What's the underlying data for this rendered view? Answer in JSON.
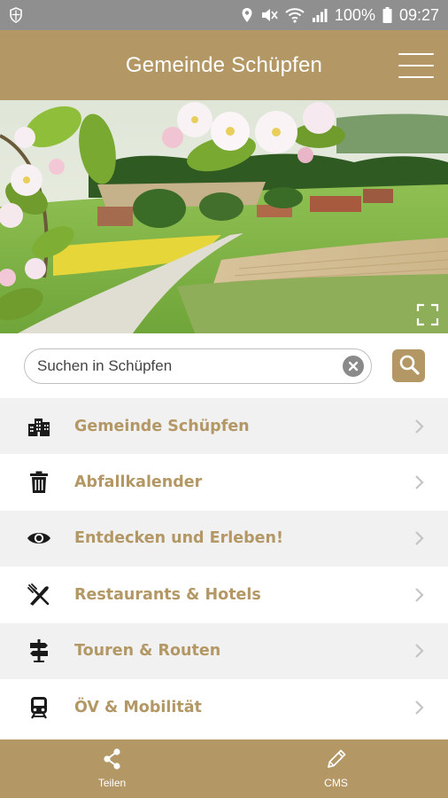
{
  "status_bar": {
    "battery": "100%",
    "time": "09:27",
    "icons": [
      "shield-icon",
      "location-icon",
      "mute-icon",
      "wifi-icon",
      "signal-icon",
      "battery-icon"
    ]
  },
  "header": {
    "title": "Gemeinde Schüpfen",
    "menu_icon": "hamburger-icon"
  },
  "hero": {
    "description_icon": "expand-icon"
  },
  "search": {
    "placeholder": "Suchen in Schüpfen",
    "value": ""
  },
  "menu": {
    "items": [
      {
        "label": "Gemeinde Schüpfen",
        "icon": "buildings-icon"
      },
      {
        "label": "Abfallkalender",
        "icon": "trash-icon"
      },
      {
        "label": "Entdecken und Erleben!",
        "icon": "eye-icon"
      },
      {
        "label": "Restaurants & Hotels",
        "icon": "fork-knife-icon"
      },
      {
        "label": "Touren & Routen",
        "icon": "signpost-icon"
      },
      {
        "label": "ÖV & Mobilität",
        "icon": "train-icon"
      }
    ]
  },
  "bottom_bar": {
    "share_label": "Teilen",
    "cms_label": "CMS"
  },
  "colors": {
    "brand": "#b39866",
    "status_bar": "#8f8f8f",
    "row_alt": "#f1f1f1"
  }
}
